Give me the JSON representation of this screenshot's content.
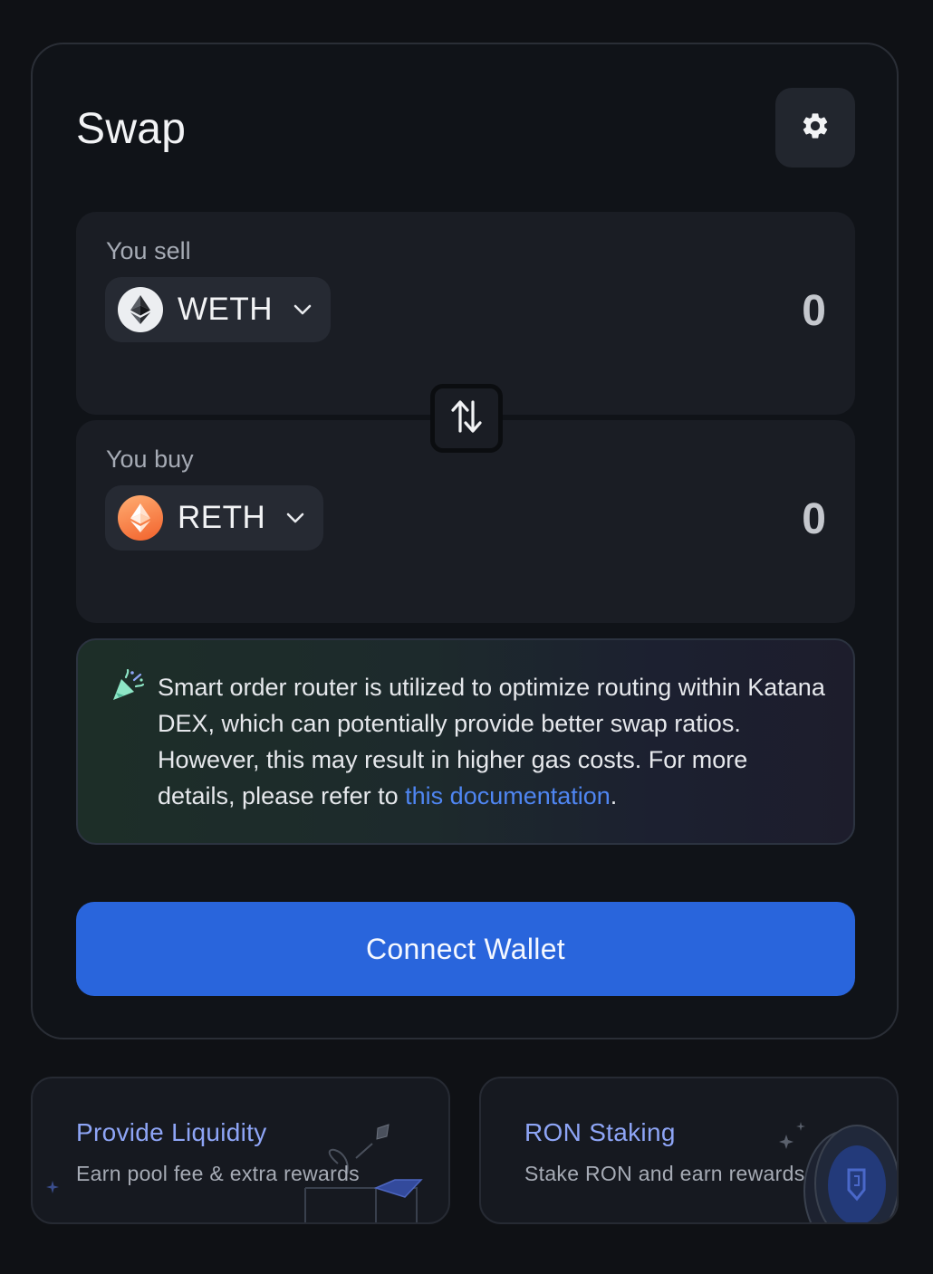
{
  "swap": {
    "title": "Swap",
    "settings_icon": "gear-icon",
    "sell": {
      "label": "You sell",
      "token": "WETH",
      "token_icon": "ethereum-icon",
      "amount": "0"
    },
    "buy": {
      "label": "You buy",
      "token": "RETH",
      "token_icon": "ethereum-icon",
      "amount": "0"
    },
    "toggle_icon": "swap-arrows-icon",
    "info": {
      "icon": "party-popper-icon",
      "text": "Smart order router is utilized to optimize routing within Katana DEX, which can potentially provide better swap ratios. However, this may result in higher gas costs. For more details, please refer to ",
      "link_text": "this documentation",
      "suffix": "."
    },
    "connect_label": "Connect Wallet"
  },
  "promos": [
    {
      "title": "Provide Liquidity",
      "subtitle": "Earn pool fee & extra rewards"
    },
    {
      "title": "RON Staking",
      "subtitle": "Stake RON and earn rewards"
    }
  ],
  "colors": {
    "background": "#0f1115",
    "panel": "#1a1d24",
    "accent": "#2965dc",
    "link": "#4f86f2",
    "promo_title": "#8ea5f6"
  }
}
